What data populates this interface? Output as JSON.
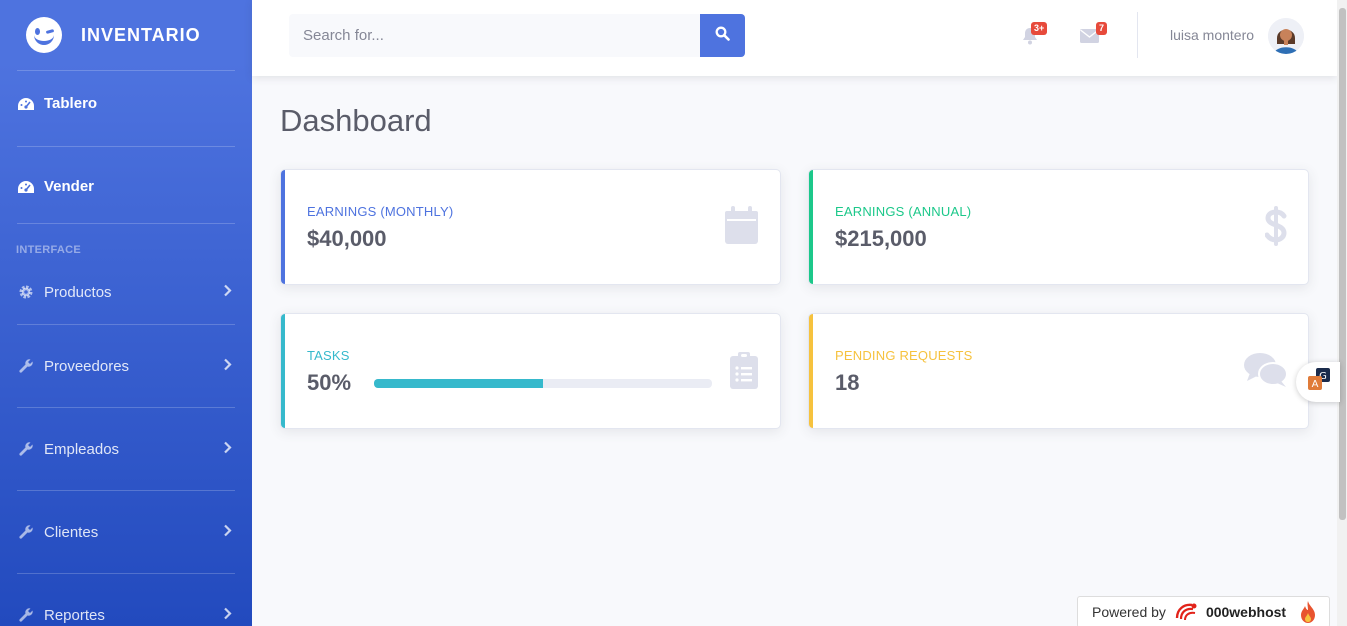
{
  "brand": {
    "name": "INVENTARIO"
  },
  "sidebar": {
    "items_top": [
      {
        "label": "Tablero",
        "icon": "tachometer-icon"
      },
      {
        "label": "Vender",
        "icon": "tachometer-icon"
      }
    ],
    "heading": "INTERFACE",
    "items": [
      {
        "label": "Productos",
        "icon": "gear-icon"
      },
      {
        "label": "Proveedores",
        "icon": "wrench-icon"
      },
      {
        "label": "Empleados",
        "icon": "wrench-icon"
      },
      {
        "label": "Clientes",
        "icon": "wrench-icon"
      },
      {
        "label": "Reportes",
        "icon": "wrench-icon"
      }
    ]
  },
  "topbar": {
    "search_placeholder": "Search for...",
    "alerts_badge": "3+",
    "messages_badge": "7",
    "user_name": "luisa montero"
  },
  "main": {
    "title": "Dashboard",
    "cards": [
      {
        "label": "EARNINGS (MONTHLY)",
        "value": "$40,000",
        "color": "#4e73df",
        "icon": "calendar-icon"
      },
      {
        "label": "EARNINGS (ANNUAL)",
        "value": "$215,000",
        "color": "#1cc88a",
        "icon": "dollar-icon"
      },
      {
        "label": "TASKS",
        "value": "50%",
        "color": "#36b9cc",
        "icon": "clipboard-list-icon",
        "progress": 0.5
      },
      {
        "label": "PENDING REQUESTS",
        "value": "18",
        "color": "#f6c23e",
        "icon": "comments-icon"
      }
    ]
  },
  "footer": {
    "powered_by": "Powered by",
    "host": "000webhost"
  }
}
